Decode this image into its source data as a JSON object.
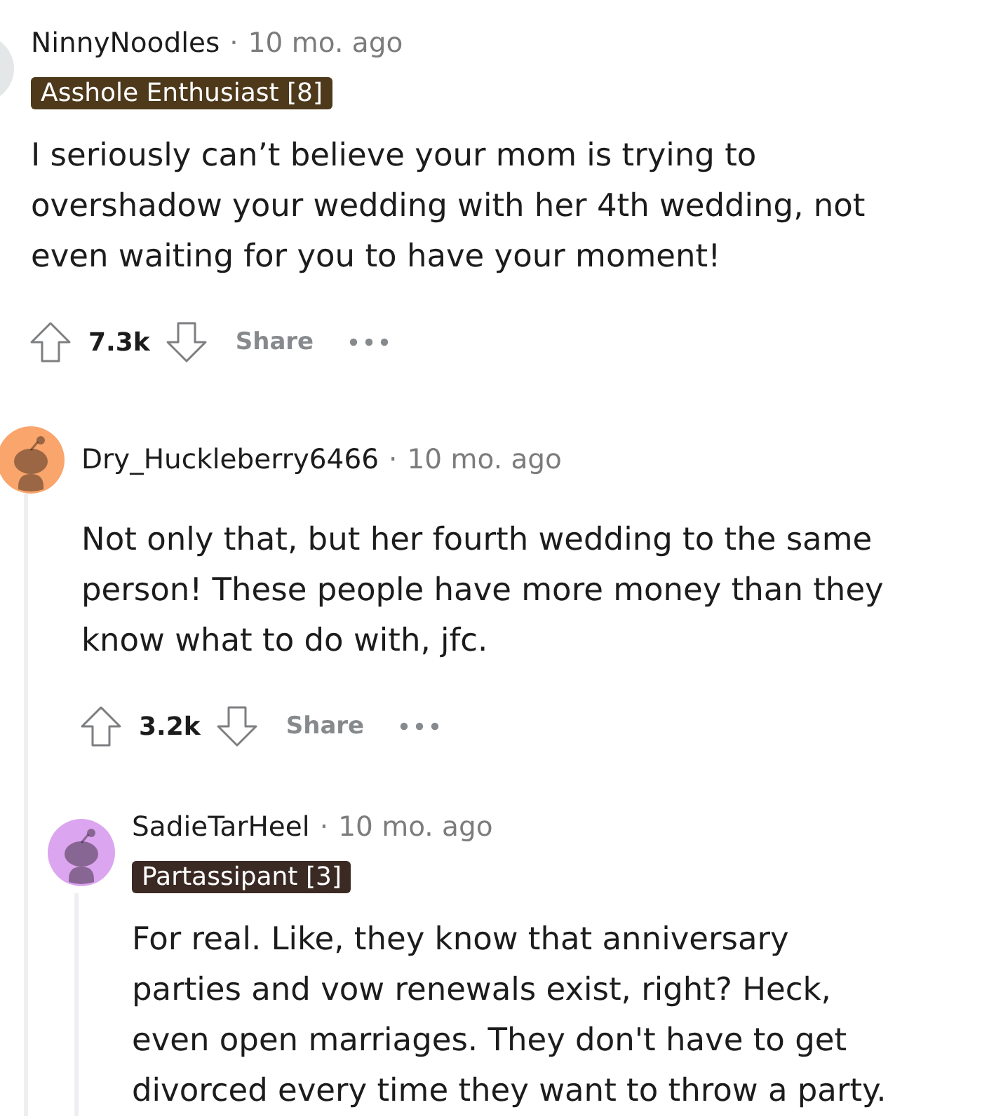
{
  "comments": [
    {
      "username": "NinnyNoodles",
      "separator": "·",
      "time": "10 mo. ago",
      "avatar": {
        "color": "#e3e7e8"
      },
      "flair": {
        "text": "Asshole Enthusiast [8]",
        "color": "#4e391b"
      },
      "body": "I seriously can’t believe your mom is trying to overshadow your wedding with her 4th wedding, not even waiting for you to have your moment!",
      "score": "7.3k",
      "share": "Share",
      "children": [
        {
          "username": "Dry_Huckleberry6466",
          "separator": "·",
          "time": "10 mo. ago",
          "avatar": {
            "color": "#f9a56c"
          },
          "body": "Not only that, but her fourth wedding to the same person! These people have more money than they know what to do with, jfc.",
          "score": "3.2k",
          "share": "Share",
          "children": [
            {
              "username": "SadieTarHeel",
              "separator": "·",
              "time": "10 mo. ago",
              "avatar": {
                "color": "#dca5ef"
              },
              "flair": {
                "text": "Partassipant [3]",
                "color": "#3b2a23"
              },
              "body": "For real. Like, they know that anniversary parties and vow renewals exist, right? Heck, even open marriages. They don't have to get divorced every time they want to throw a party."
            }
          ]
        }
      ]
    }
  ]
}
